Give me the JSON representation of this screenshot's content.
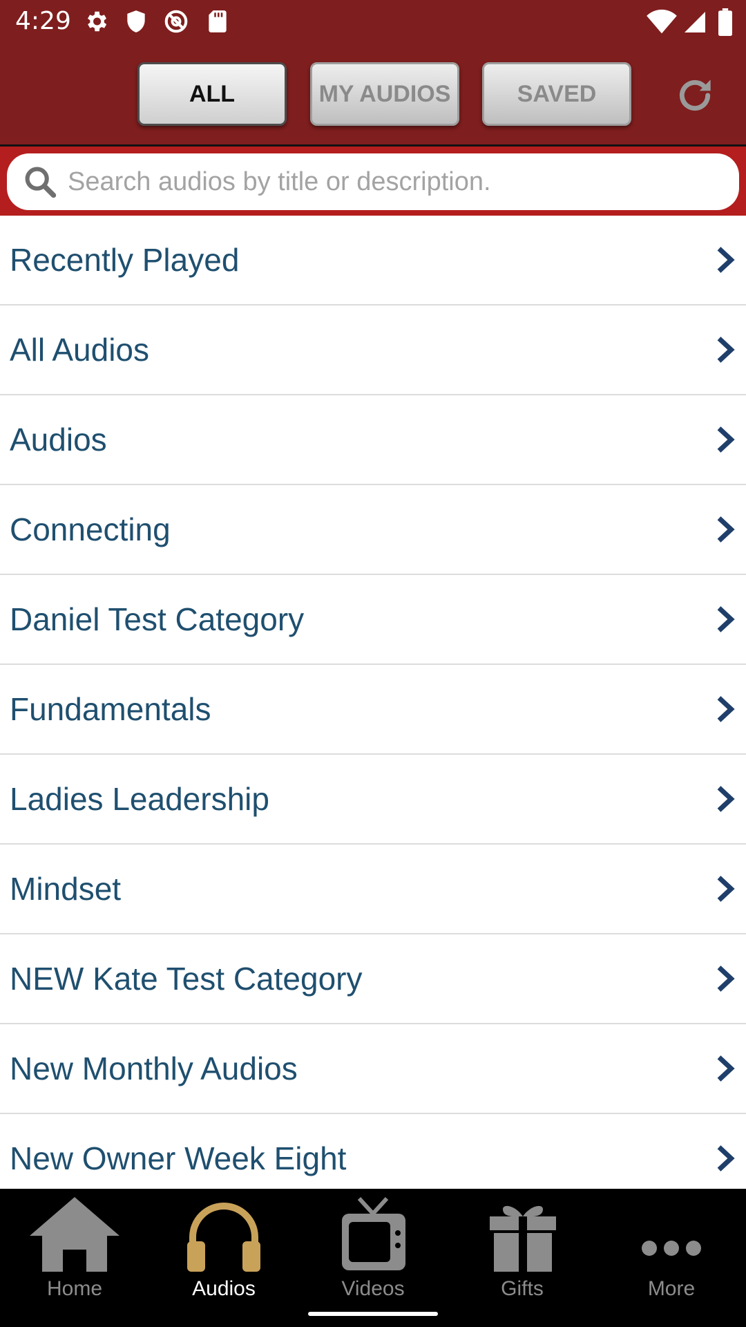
{
  "status_bar": {
    "time": "4:29"
  },
  "header": {
    "segments": [
      {
        "label": "ALL",
        "active": true
      },
      {
        "label": "MY AUDIOS",
        "active": false
      },
      {
        "label": "SAVED",
        "active": false
      }
    ],
    "refresh_icon": "refresh-icon"
  },
  "search": {
    "placeholder": "Search audios by title or description.",
    "value": ""
  },
  "categories": [
    {
      "label": "Recently Played"
    },
    {
      "label": "All Audios"
    },
    {
      "label": "Audios"
    },
    {
      "label": "Connecting"
    },
    {
      "label": "Daniel Test Category"
    },
    {
      "label": "Fundamentals"
    },
    {
      "label": "Ladies Leadership"
    },
    {
      "label": "Mindset"
    },
    {
      "label": "NEW Kate Test Category"
    },
    {
      "label": "New Monthly Audios"
    },
    {
      "label": "New Owner Week Eight"
    }
  ],
  "tabbar": {
    "tabs": [
      {
        "label": "Home",
        "icon": "home-icon",
        "active": false
      },
      {
        "label": "Audios",
        "icon": "headphones-icon",
        "active": true
      },
      {
        "label": "Videos",
        "icon": "tv-icon",
        "active": false
      },
      {
        "label": "Gifts",
        "icon": "gift-icon",
        "active": false
      },
      {
        "label": "More",
        "icon": "more-dots-icon",
        "active": false
      }
    ]
  },
  "colors": {
    "header_bg": "#7f1e1e",
    "search_bg": "#b51e1e",
    "list_text": "#1f4f6f",
    "active_tab_icon": "#c9a25a"
  }
}
